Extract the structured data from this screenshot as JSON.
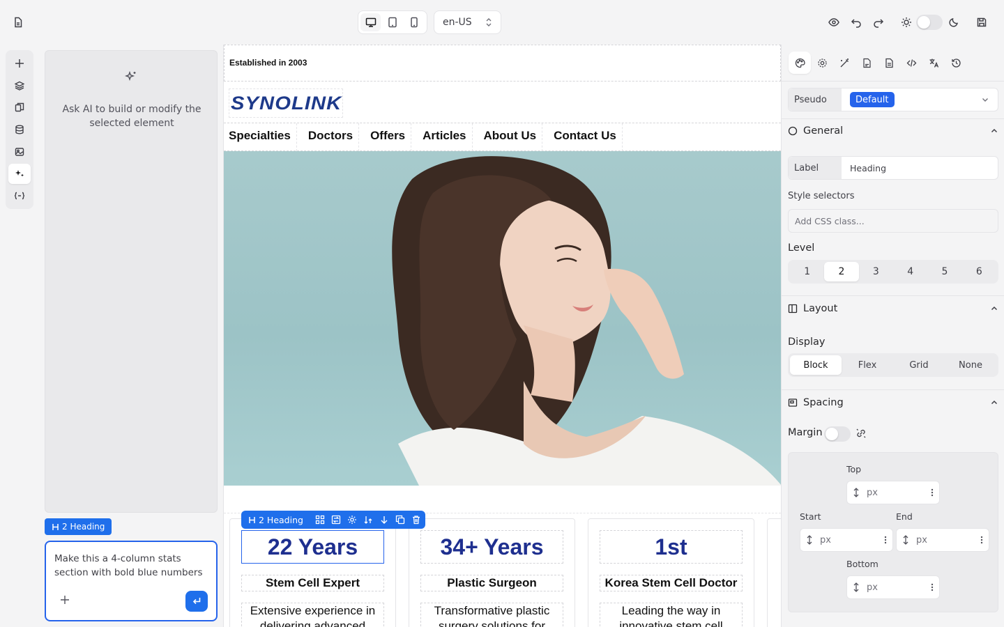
{
  "topbar": {
    "locale": "en-US"
  },
  "ai": {
    "hint": "Ask AI to build or modify the selected element",
    "selected_tag": "2 Heading",
    "prompt": "Make this a 4-column stats section with bold blue numbers"
  },
  "site": {
    "established": "Established in 2003",
    "logo": "SYNOLINK",
    "nav": [
      "Specialties",
      "Doctors",
      "Offers",
      "Articles",
      "About Us",
      "Contact Us"
    ],
    "stats": [
      {
        "number": "22 Years",
        "title": "Stem Cell Expert",
        "desc": "Extensive experience in delivering advanced stem"
      },
      {
        "number": "34+ Years",
        "title": "Plastic Surgeon",
        "desc": "Transformative plastic surgery solutions for natural"
      },
      {
        "number": "1st",
        "title": "Korea Stem Cell Doctor",
        "desc": "Leading the way in innovative stem cell"
      }
    ],
    "toolbar_label": "2 Heading"
  },
  "panel": {
    "pseudo_label": "Pseudo",
    "pseudo_value": "Default",
    "general": "General",
    "label_key": "Label",
    "label_value": "Heading",
    "style_selectors": "Style selectors",
    "css_placeholder": "Add CSS class...",
    "level_label": "Level",
    "levels": [
      "1",
      "2",
      "3",
      "4",
      "5",
      "6"
    ],
    "level_selected": 2,
    "layout": "Layout",
    "display_label": "Display",
    "display_options": [
      "Block",
      "Flex",
      "Grid",
      "None"
    ],
    "spacing": "Spacing",
    "margin_label": "Margin",
    "box": {
      "top": "Top",
      "start": "Start",
      "end": "End",
      "bottom": "Bottom",
      "unit": "px"
    }
  },
  "colors": {
    "accent": "#1f6feb",
    "brand_navy": "#1e2f8f"
  }
}
